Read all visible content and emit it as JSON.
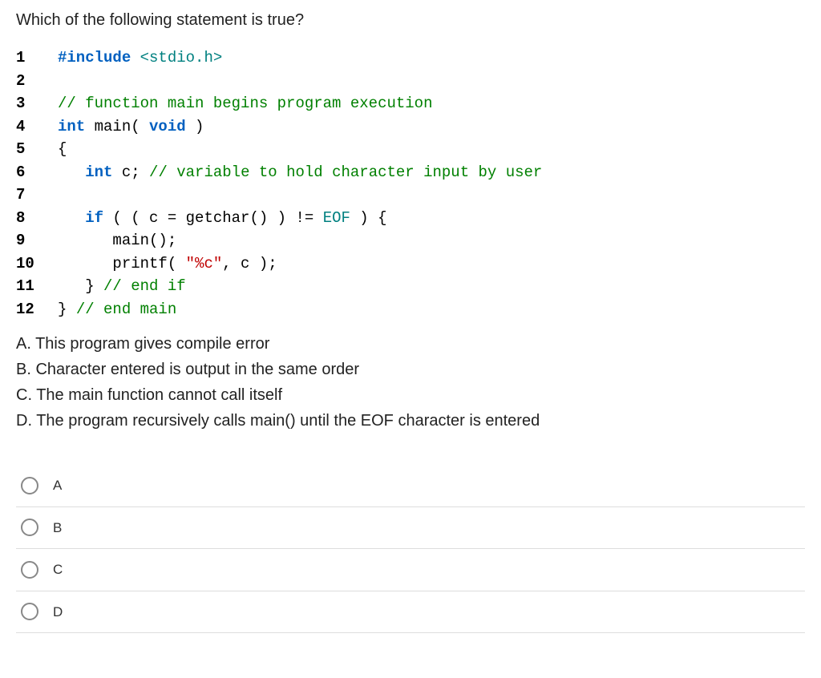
{
  "question": "Which of the following statement is true?",
  "code_lines": [
    {
      "n": "1",
      "tokens": [
        {
          "t": "#include ",
          "c": "kw-blue"
        },
        {
          "t": "<stdio.h>",
          "c": "kw-teal"
        }
      ]
    },
    {
      "n": "2",
      "tokens": []
    },
    {
      "n": "3",
      "tokens": [
        {
          "t": "// function main begins program execution",
          "c": "kw-green"
        }
      ]
    },
    {
      "n": "4",
      "tokens": [
        {
          "t": "int ",
          "c": "kw-blue"
        },
        {
          "t": "main( ",
          "c": "kw-plain"
        },
        {
          "t": "void",
          "c": "kw-blue"
        },
        {
          "t": " )",
          "c": "kw-plain"
        }
      ]
    },
    {
      "n": "5",
      "tokens": [
        {
          "t": "{",
          "c": "kw-plain"
        }
      ]
    },
    {
      "n": "6",
      "tokens": [
        {
          "t": "   ",
          "c": "kw-plain"
        },
        {
          "t": "int ",
          "c": "kw-blue"
        },
        {
          "t": "c; ",
          "c": "kw-plain"
        },
        {
          "t": "// variable to hold character input by user",
          "c": "kw-green"
        }
      ]
    },
    {
      "n": "7",
      "tokens": []
    },
    {
      "n": "8",
      "tokens": [
        {
          "t": "   ",
          "c": "kw-plain"
        },
        {
          "t": "if",
          "c": "kw-blue"
        },
        {
          "t": " ( ( c = getchar() ) != ",
          "c": "kw-plain"
        },
        {
          "t": "EOF",
          "c": "kw-teal"
        },
        {
          "t": " ) {",
          "c": "kw-plain"
        }
      ]
    },
    {
      "n": "9",
      "tokens": [
        {
          "t": "      main();",
          "c": "kw-plain"
        }
      ]
    },
    {
      "n": "10",
      "tokens": [
        {
          "t": "      printf( ",
          "c": "kw-plain"
        },
        {
          "t": "\"%c\"",
          "c": "kw-red"
        },
        {
          "t": ", c );",
          "c": "kw-plain"
        }
      ]
    },
    {
      "n": "11",
      "tokens": [
        {
          "t": "   } ",
          "c": "kw-plain"
        },
        {
          "t": "// end if",
          "c": "kw-green"
        }
      ]
    },
    {
      "n": "12",
      "tokens": [
        {
          "t": "} ",
          "c": "kw-plain"
        },
        {
          "t": "// end main",
          "c": "kw-green"
        }
      ]
    }
  ],
  "option_texts": [
    "A. This program gives compile error",
    "B. Character entered is output in the same order",
    "C. The main function cannot call itself",
    "D. The program recursively calls main() until the EOF character is entered"
  ],
  "answers": [
    "A",
    "B",
    "C",
    "D"
  ]
}
